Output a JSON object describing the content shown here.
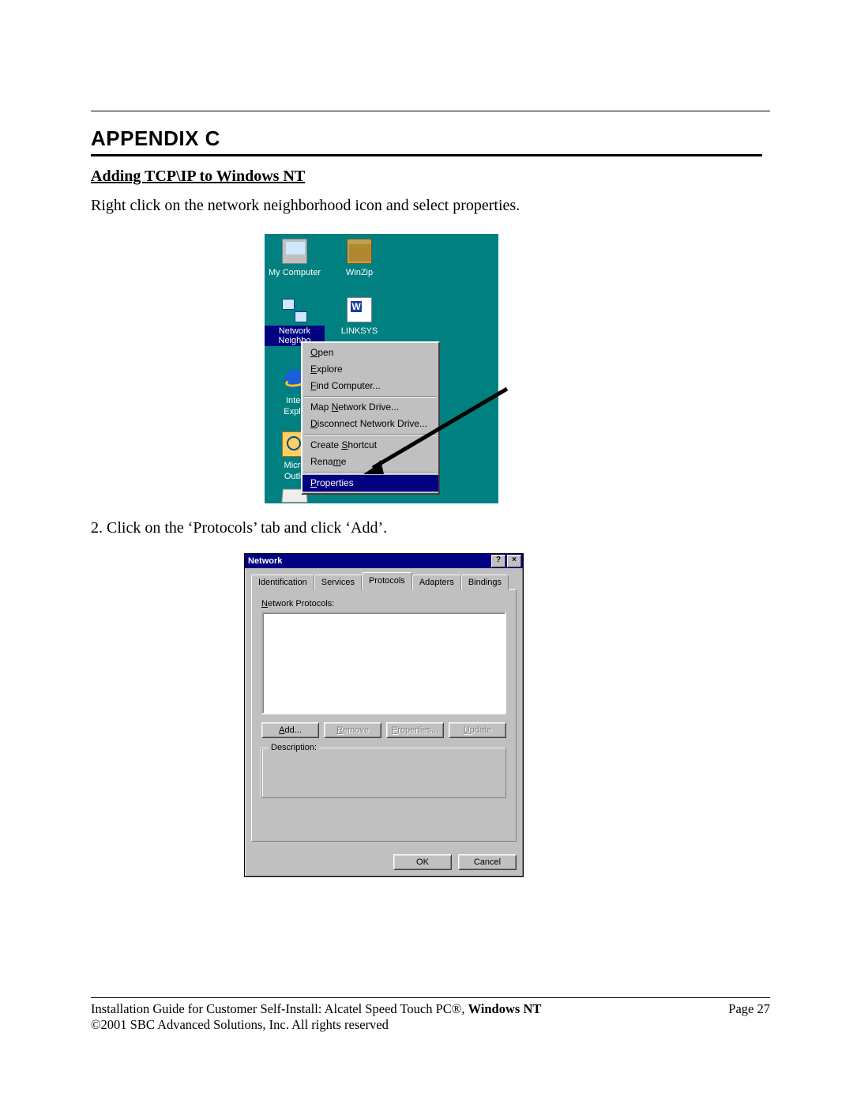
{
  "header": {
    "appendix": "APPENDIX  C",
    "subheading": "Adding TCP\\IP to Windows NT",
    "intro": "Right click on the network neighborhood icon and select properties."
  },
  "desktop": {
    "icons": {
      "my_computer": "My Computer",
      "winzip": "WinZip",
      "network_neighborhood": "Network Neighbo",
      "linksys": "LINKSYS",
      "ie_line1": "Inter",
      "ie_line2": "Explo",
      "outlook_line1": "Micro",
      "outlook_line2": "Outlo"
    },
    "context_menu": {
      "open": "Open",
      "explore": "Explore",
      "find": "Find Computer...",
      "map": "Map Network Drive...",
      "disconnect": "Disconnect Network Drive...",
      "shortcut": "Create Shortcut",
      "rename": "Rename",
      "properties": "Properties"
    }
  },
  "step2": "2.  Click on the ‘Protocols’ tab and click ‘Add’.",
  "dialog": {
    "title": "Network",
    "help_btn": "?",
    "close_btn": "×",
    "tabs": {
      "identification": "Identification",
      "services": "Services",
      "protocols": "Protocols",
      "adapters": "Adapters",
      "bindings": "Bindings"
    },
    "panel": {
      "list_label_pre": "N",
      "list_label_post": "etwork Protocols:",
      "buttons": {
        "add_pre": "A",
        "add_post": "dd...",
        "remove_pre": "R",
        "remove_post": "emove",
        "props_pre": "P",
        "props_post": "roperties...",
        "update_pre": "U",
        "update_post": "pdate"
      },
      "description_legend": "Description:"
    },
    "ok": "OK",
    "cancel": "Cancel"
  },
  "footer": {
    "left_a": "Installation Guide for Customer Self-Install: Alcatel Speed Touch PC®, ",
    "left_b": "Windows NT",
    "right": "Page 27",
    "copyright": "©2001 SBC Advanced Solutions, Inc.  All rights reserved"
  }
}
